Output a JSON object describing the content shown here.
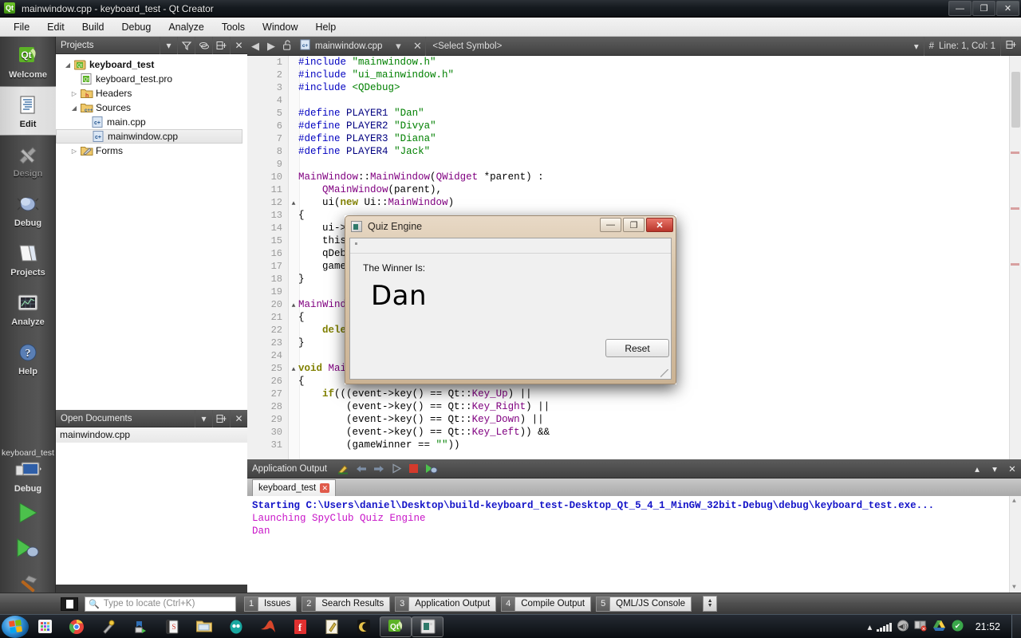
{
  "window": {
    "title": "mainwindow.cpp - keyboard_test - Qt Creator",
    "app_icon": "qt-logo-icon",
    "controls": {
      "minimize": "—",
      "maximize": "❐",
      "close": "✕"
    }
  },
  "menubar": {
    "items": [
      "File",
      "Edit",
      "Build",
      "Debug",
      "Analyze",
      "Tools",
      "Window",
      "Help"
    ]
  },
  "modebar": {
    "items": [
      {
        "label": "Welcome",
        "icon": "qt-welcome-icon",
        "state": "normal"
      },
      {
        "label": "Edit",
        "icon": "document-lines-icon",
        "state": "active"
      },
      {
        "label": "Design",
        "icon": "pencil-ruler-icon",
        "state": "disabled"
      },
      {
        "label": "Debug",
        "icon": "bug-icon",
        "state": "normal"
      },
      {
        "label": "Projects",
        "icon": "folder-book-icon",
        "state": "normal"
      },
      {
        "label": "Analyze",
        "icon": "monitor-grid-icon",
        "state": "normal"
      },
      {
        "label": "Help",
        "icon": "question-circle-icon",
        "state": "normal"
      }
    ],
    "kit": {
      "project_name": "keyboard_test",
      "build_config": "Debug",
      "kit_icon": "desktop-monitor-icon",
      "run_button": "run-green-arrow-icon",
      "debug_button": "run-debug-icon",
      "build_button": "hammer-icon"
    }
  },
  "projects_dock": {
    "title": "Projects",
    "buttons": [
      "chevron-down-icon",
      "filter-icon",
      "link-sync-icon",
      "split-icon",
      "close-icon"
    ],
    "tree": [
      {
        "depth": 0,
        "label": "keyboard_test",
        "icon": "qt-project-icon",
        "arrow": "open",
        "bold": true,
        "selected": false
      },
      {
        "depth": 1,
        "label": "keyboard_test.pro",
        "icon": "qt-pro-file-icon",
        "arrow": "none",
        "bold": false,
        "selected": false
      },
      {
        "depth": 1,
        "label": "Headers",
        "icon": "folder-h-icon",
        "arrow": "closed",
        "bold": false,
        "selected": false
      },
      {
        "depth": 1,
        "label": "Sources",
        "icon": "folder-cpp-icon",
        "arrow": "open",
        "bold": false,
        "selected": false
      },
      {
        "depth": 2,
        "label": "main.cpp",
        "icon": "cpp-file-icon",
        "arrow": "none",
        "bold": false,
        "selected": false
      },
      {
        "depth": 2,
        "label": "mainwindow.cpp",
        "icon": "cpp-file-icon",
        "arrow": "none",
        "bold": false,
        "selected": true
      },
      {
        "depth": 1,
        "label": "Forms",
        "icon": "folder-ui-icon",
        "arrow": "closed",
        "bold": false,
        "selected": false
      }
    ]
  },
  "opendocs_dock": {
    "title": "Open Documents",
    "buttons": [
      "chevron-down-icon",
      "split-icon",
      "close-icon"
    ],
    "items": [
      "mainwindow.cpp"
    ]
  },
  "editor": {
    "toolbar": {
      "back": "arrow-left-icon",
      "forward": "arrow-right-icon",
      "lock": "unlocked-padlock-icon",
      "file_icon": "cpp-file-icon",
      "filename": "mainwindow.cpp",
      "dropdown": "chevron-down-icon",
      "close": "close-icon",
      "symbol_selector": "<Select Symbol>",
      "symbol_dropdown": "chevron-down-icon",
      "line_col_icon": "hash-icon",
      "line_col": "Line: 1, Col: 1",
      "split": "split-icon"
    },
    "code": [
      {
        "n": 1,
        "fold": "",
        "tokens": [
          [
            "pre",
            "#include"
          ],
          [
            "plain",
            " "
          ],
          [
            "str",
            "\"mainwindow.h\""
          ]
        ]
      },
      {
        "n": 2,
        "fold": "",
        "tokens": [
          [
            "pre",
            "#include"
          ],
          [
            "plain",
            " "
          ],
          [
            "str",
            "\"ui_mainwindow.h\""
          ]
        ]
      },
      {
        "n": 3,
        "fold": "",
        "tokens": [
          [
            "pre",
            "#include"
          ],
          [
            "plain",
            " "
          ],
          [
            "str",
            "<QDebug>"
          ]
        ]
      },
      {
        "n": 4,
        "fold": "",
        "tokens": []
      },
      {
        "n": 5,
        "fold": "",
        "tokens": [
          [
            "pre",
            "#define"
          ],
          [
            "plain",
            " "
          ],
          [
            "num",
            "PLAYER1"
          ],
          [
            "plain",
            " "
          ],
          [
            "str",
            "\"Dan\""
          ]
        ]
      },
      {
        "n": 6,
        "fold": "",
        "tokens": [
          [
            "pre",
            "#define"
          ],
          [
            "plain",
            " "
          ],
          [
            "num",
            "PLAYER2"
          ],
          [
            "plain",
            " "
          ],
          [
            "str",
            "\"Divya\""
          ]
        ]
      },
      {
        "n": 7,
        "fold": "",
        "tokens": [
          [
            "pre",
            "#define"
          ],
          [
            "plain",
            " "
          ],
          [
            "num",
            "PLAYER3"
          ],
          [
            "plain",
            " "
          ],
          [
            "str",
            "\"Diana\""
          ]
        ]
      },
      {
        "n": 8,
        "fold": "",
        "tokens": [
          [
            "pre",
            "#define"
          ],
          [
            "plain",
            " "
          ],
          [
            "num",
            "PLAYER4"
          ],
          [
            "plain",
            " "
          ],
          [
            "str",
            "\"Jack\""
          ]
        ]
      },
      {
        "n": 9,
        "fold": "",
        "tokens": []
      },
      {
        "n": 10,
        "fold": "",
        "tokens": [
          [
            "cls",
            "MainWindow"
          ],
          [
            "plain",
            "::"
          ],
          [
            "cls",
            "MainWindow"
          ],
          [
            "plain",
            "("
          ],
          [
            "cls",
            "QWidget"
          ],
          [
            "plain",
            " *parent) :"
          ]
        ]
      },
      {
        "n": 11,
        "fold": "",
        "tokens": [
          [
            "plain",
            "    "
          ],
          [
            "cls",
            "QMainWindow"
          ],
          [
            "plain",
            "(parent),"
          ]
        ]
      },
      {
        "n": 12,
        "fold": "▲",
        "tokens": [
          [
            "plain",
            "    ui("
          ],
          [
            "kw",
            "new"
          ],
          [
            "plain",
            " Ui::"
          ],
          [
            "cls",
            "MainWindow"
          ],
          [
            "plain",
            ")"
          ]
        ]
      },
      {
        "n": 13,
        "fold": "",
        "tokens": [
          [
            "plain",
            "{"
          ]
        ]
      },
      {
        "n": 14,
        "fold": "",
        "tokens": [
          [
            "plain",
            "    ui->s"
          ]
        ]
      },
      {
        "n": 15,
        "fold": "",
        "tokens": [
          [
            "plain",
            "    this"
          ]
        ]
      },
      {
        "n": 16,
        "fold": "",
        "tokens": [
          [
            "plain",
            "    qDeb"
          ]
        ]
      },
      {
        "n": 17,
        "fold": "",
        "tokens": [
          [
            "plain",
            "    game"
          ]
        ]
      },
      {
        "n": 18,
        "fold": "",
        "tokens": [
          [
            "plain",
            "}"
          ]
        ]
      },
      {
        "n": 19,
        "fold": "",
        "tokens": []
      },
      {
        "n": 20,
        "fold": "▲",
        "tokens": [
          [
            "cls",
            "MainWind"
          ]
        ]
      },
      {
        "n": 21,
        "fold": "",
        "tokens": [
          [
            "plain",
            "{"
          ]
        ]
      },
      {
        "n": 22,
        "fold": "",
        "tokens": [
          [
            "plain",
            "    "
          ],
          [
            "kw",
            "dele"
          ]
        ]
      },
      {
        "n": 23,
        "fold": "",
        "tokens": [
          [
            "plain",
            "}"
          ]
        ]
      },
      {
        "n": 24,
        "fold": "",
        "tokens": []
      },
      {
        "n": 25,
        "fold": "▲",
        "tokens": [
          [
            "kw",
            "void"
          ],
          [
            "plain",
            " "
          ],
          [
            "cls",
            "Mai"
          ]
        ]
      },
      {
        "n": 26,
        "fold": "",
        "tokens": [
          [
            "plain",
            "{"
          ]
        ]
      },
      {
        "n": 27,
        "fold": "",
        "tokens": [
          [
            "plain",
            "    "
          ],
          [
            "kw",
            "if"
          ],
          [
            "plain",
            "(((event->"
          ],
          [
            "id",
            "key"
          ],
          [
            "plain",
            "() == Qt::"
          ],
          [
            "cls",
            "Key_Up"
          ],
          [
            "plain",
            ") ||"
          ]
        ]
      },
      {
        "n": 28,
        "fold": "",
        "tokens": [
          [
            "plain",
            "        (event->"
          ],
          [
            "id",
            "key"
          ],
          [
            "plain",
            "() == Qt::"
          ],
          [
            "cls",
            "Key_Right"
          ],
          [
            "plain",
            ") ||"
          ]
        ]
      },
      {
        "n": 29,
        "fold": "",
        "tokens": [
          [
            "plain",
            "        (event->"
          ],
          [
            "id",
            "key"
          ],
          [
            "plain",
            "() == Qt::"
          ],
          [
            "cls",
            "Key_Down"
          ],
          [
            "plain",
            ") ||"
          ]
        ]
      },
      {
        "n": 30,
        "fold": "",
        "tokens": [
          [
            "plain",
            "        (event->"
          ],
          [
            "id",
            "key"
          ],
          [
            "plain",
            "() == Qt::"
          ],
          [
            "cls",
            "Key_Left"
          ],
          [
            "plain",
            ")) &&"
          ]
        ]
      },
      {
        "n": 31,
        "fold": "",
        "tokens": [
          [
            "plain",
            "        (gameWinner == "
          ],
          [
            "str",
            "\"\""
          ],
          [
            "plain",
            "))"
          ]
        ]
      }
    ]
  },
  "output_pane": {
    "title": "Application Output",
    "toolbar_icons": [
      "highlight-filter-icon",
      "arrow-left-icon",
      "arrow-right-icon",
      "play-icon",
      "stop-icon",
      "attach-debugger-icon"
    ],
    "right_icons": [
      "chevron-up-icon",
      "chevron-down-icon",
      "close-icon"
    ],
    "tabs": [
      {
        "label": "keyboard_test",
        "closable": true
      }
    ],
    "lines": [
      {
        "style": "blue",
        "text": "Starting C:\\Users\\daniel\\Desktop\\build-keyboard_test-Desktop_Qt_5_4_1_MinGW_32bit-Debug\\debug\\keyboard_test.exe..."
      },
      {
        "style": "magenta",
        "text": "Launching SpyClub Quiz Engine"
      },
      {
        "style": "magenta",
        "text": "Dan"
      }
    ]
  },
  "statusbar": {
    "sidebar_toggle": "sidebar-toggle-icon",
    "locator": {
      "icon": "search-icon",
      "placeholder": "Type to locate (Ctrl+K)",
      "value": ""
    },
    "tabs": [
      {
        "number": "1",
        "label": "Issues"
      },
      {
        "number": "2",
        "label": "Search Results"
      },
      {
        "number": "3",
        "label": "Application Output"
      },
      {
        "number": "4",
        "label": "Compile Output"
      },
      {
        "number": "5",
        "label": "QML/JS Console"
      }
    ],
    "updown": "up-down-spinner-icon"
  },
  "dialog": {
    "title": "Quiz Engine",
    "icon": "quiz-engine-app-icon",
    "controls": {
      "minimize": "—",
      "maximize": "❐",
      "close": "✕"
    },
    "winner_label": "The Winner Is:",
    "winner_name": "Dan",
    "reset_button": "Reset"
  },
  "taskbar": {
    "start": "windows-start-orb-icon",
    "items": [
      {
        "icon": "app-grid-icon",
        "running": false
      },
      {
        "icon": "chrome-icon",
        "running": false
      },
      {
        "icon": "shortcut-tool-icon",
        "running": false
      },
      {
        "icon": "blue-arrow-icon",
        "running": false
      },
      {
        "icon": "book-icon",
        "running": false
      },
      {
        "icon": "explorer-folder-icon",
        "running": false
      },
      {
        "icon": "teal-egg-icon",
        "running": false
      },
      {
        "icon": "matlab-icon",
        "running": false
      },
      {
        "icon": "f-red-icon",
        "running": false
      },
      {
        "icon": "notepad-icon",
        "running": false
      },
      {
        "icon": "moon-icon",
        "running": false
      },
      {
        "icon": "qt-creator-icon",
        "running": true
      },
      {
        "icon": "quiz-engine-app-icon",
        "running": true
      }
    ],
    "tray": {
      "expand": "chevron-up-icon",
      "icons": [
        "network-signal-icon",
        "volume-icon",
        "network-error-icon",
        "google-drive-icon",
        "dropbox-icon"
      ],
      "clock": "21:52",
      "show_desktop": "show-desktop-button"
    }
  },
  "colors": {
    "accent_qt_green": "#41cd52",
    "titlebar_dark": "#151a1f",
    "output_blue": "#1414c8",
    "output_magenta": "#c814c8",
    "code_preproc": "#0000c0",
    "code_string": "#008000",
    "code_keyword": "#808000",
    "code_class": "#800080"
  }
}
